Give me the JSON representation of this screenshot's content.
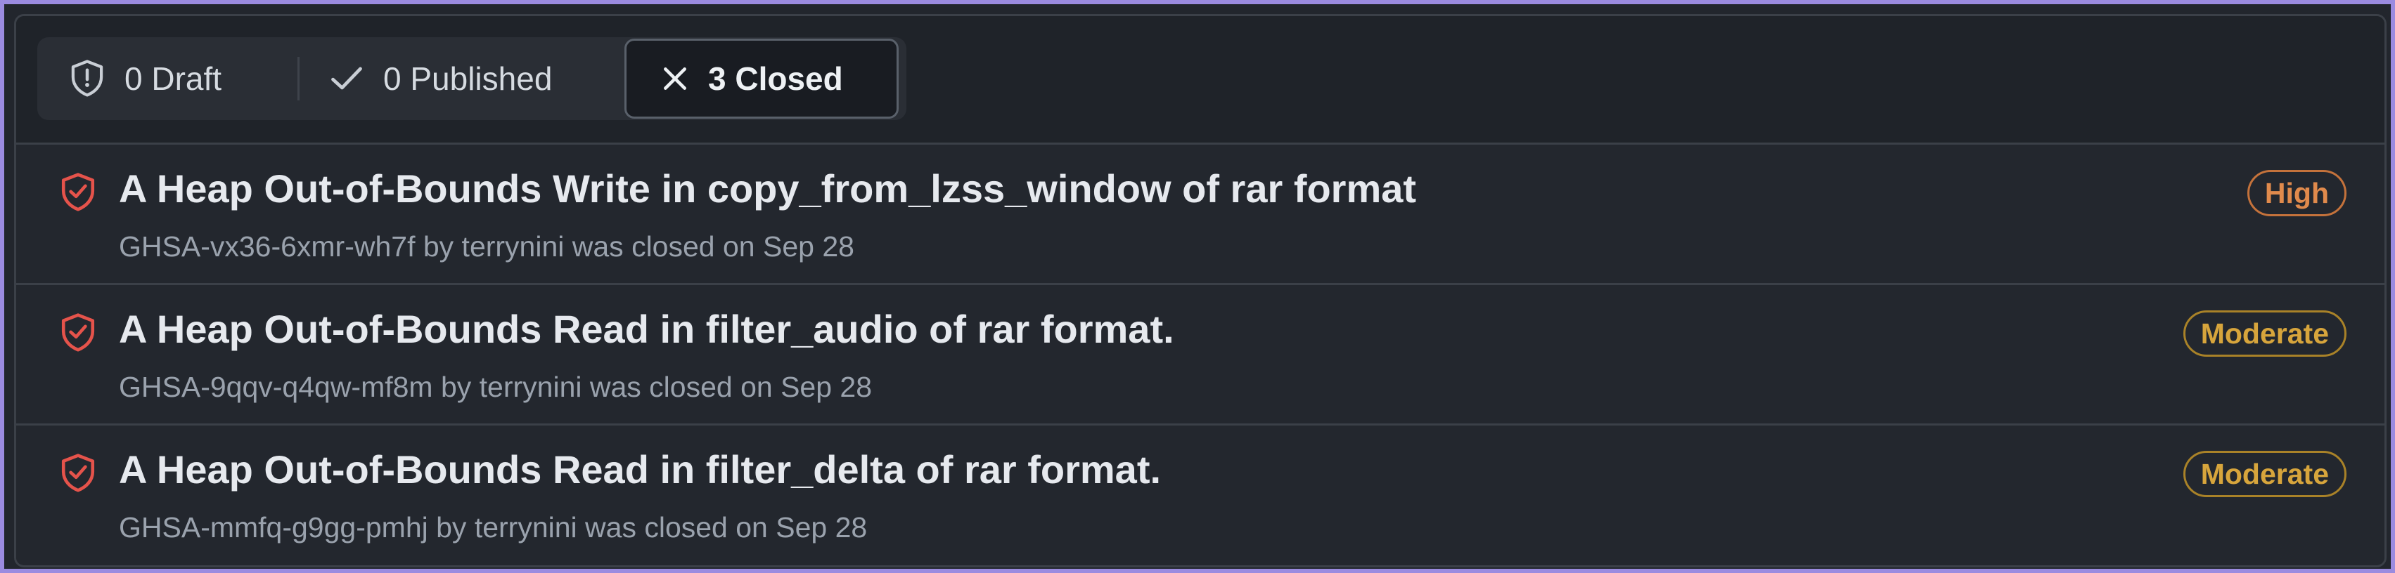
{
  "tabs": {
    "draft": {
      "label": "0 Draft",
      "icon": "shield-exclamation-icon"
    },
    "published": {
      "label": "0 Published",
      "icon": "check-icon"
    },
    "closed": {
      "label": "3 Closed",
      "icon": "x-icon",
      "selected": true
    }
  },
  "advisories": [
    {
      "title": "A Heap Out-of-Bounds Write in copy_from_lzss_window of rar format",
      "meta": "GHSA-vx36-6xmr-wh7f by terrynini was closed on Sep 28",
      "severity": "High",
      "severity_color": "#e08a4c",
      "icon": "shield-check-icon"
    },
    {
      "title": "A Heap Out-of-Bounds Read in filter_audio of rar format.",
      "meta": "GHSA-9qqv-q4qw-mf8m by terrynini was closed on Sep 28",
      "severity": "Moderate",
      "severity_color": "#d7a53c",
      "icon": "shield-check-icon"
    },
    {
      "title": "A Heap Out-of-Bounds Read in filter_delta of rar format.",
      "meta": "GHSA-mmfq-g9gg-pmhj by terrynini was closed on Sep 28",
      "severity": "Moderate",
      "severity_color": "#d7a53c",
      "icon": "shield-check-icon"
    }
  ],
  "colors": {
    "accent_frame": "#9b8be0",
    "shield_icon": "#e5534b"
  }
}
